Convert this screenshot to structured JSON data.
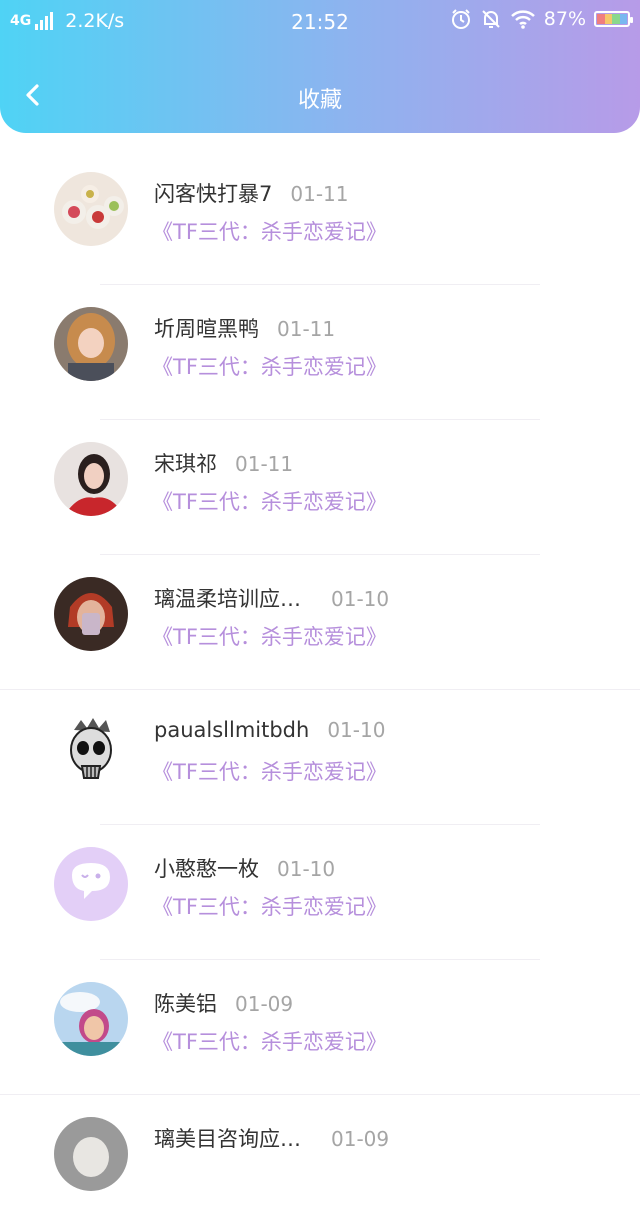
{
  "status_bar": {
    "network": "4G",
    "speed": "2.2K/s",
    "time": "21:52",
    "battery": "87%"
  },
  "header": {
    "title": "收藏"
  },
  "favorites": [
    {
      "name": "闪客快打暴7",
      "date": "01-11",
      "book": "《TF三代：杀手恋爱记》"
    },
    {
      "name": "圻周暄黑鸭",
      "date": "01-11",
      "book": "《TF三代：杀手恋爱记》"
    },
    {
      "name": "宋琪祁",
      "date": "01-11",
      "book": "《TF三代：杀手恋爱记》"
    },
    {
      "name": "璃温柔培训应…",
      "date": "01-10",
      "book": "《TF三代：杀手恋爱记》"
    },
    {
      "name": "paualsllmitbdh",
      "date": "01-10",
      "book": "《TF三代：杀手恋爱记》"
    },
    {
      "name": "小憨憨一枚",
      "date": "01-10",
      "book": "《TF三代：杀手恋爱记》"
    },
    {
      "name": "陈美铝",
      "date": "01-09",
      "book": "《TF三代：杀手恋爱记》"
    },
    {
      "name": "璃美目咨询应…",
      "date": "01-09",
      "book": ""
    }
  ],
  "colors": {
    "header_start": "#4fd3f5",
    "header_end": "#b79be8",
    "book_title": "#b68fdc",
    "date": "#a5a5a5"
  },
  "icons": [
    "back-arrow-icon",
    "alarm-icon",
    "mute-bell-icon",
    "wifi-icon",
    "battery-icon",
    "signal-icon"
  ]
}
